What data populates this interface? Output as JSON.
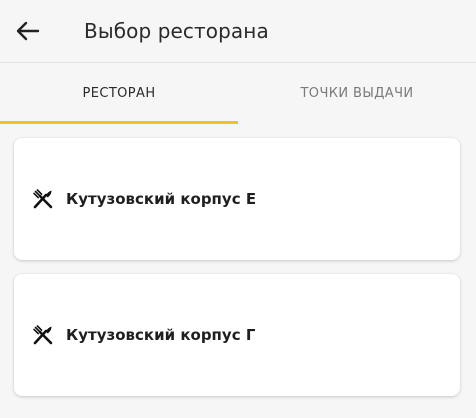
{
  "header": {
    "title": "Выбор ресторана",
    "back_icon": "arrow-left-icon"
  },
  "tabs": [
    {
      "label": "РЕСТОРАН",
      "selected": true
    },
    {
      "label": "ТОЧКИ ВЫДАЧИ",
      "selected": false
    }
  ],
  "colors": {
    "accent": "#f1c21a",
    "background": "#f6f6f6",
    "card": "#ffffff"
  },
  "restaurants": [
    {
      "name": "Кутузовский корпус Е",
      "icon": "fork-knife-icon"
    },
    {
      "name": "Кутузовский корпус Г",
      "icon": "fork-knife-icon"
    }
  ]
}
